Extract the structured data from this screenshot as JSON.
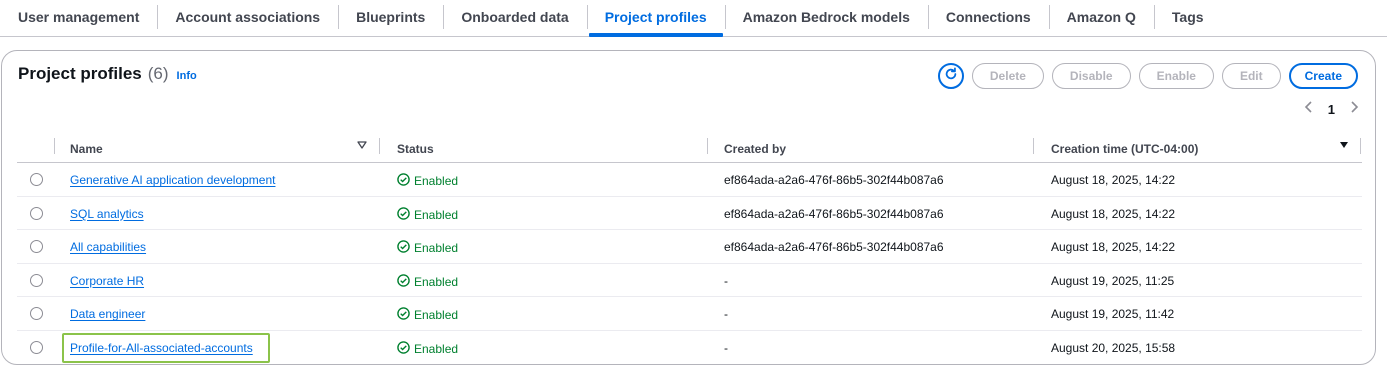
{
  "tabs": [
    {
      "label": "User management",
      "active": false
    },
    {
      "label": "Account associations",
      "active": false
    },
    {
      "label": "Blueprints",
      "active": false
    },
    {
      "label": "Onboarded data",
      "active": false
    },
    {
      "label": "Project profiles",
      "active": true
    },
    {
      "label": "Amazon Bedrock models",
      "active": false
    },
    {
      "label": "Connections",
      "active": false
    },
    {
      "label": "Amazon Q",
      "active": false
    },
    {
      "label": "Tags",
      "active": false
    }
  ],
  "panel": {
    "title": "Project profiles",
    "count": "(6)",
    "info": "Info"
  },
  "actions": {
    "refresh_icon": "refresh-icon",
    "delete": "Delete",
    "disable": "Disable",
    "enable": "Enable",
    "edit": "Edit",
    "create": "Create"
  },
  "pagination": {
    "page": "1"
  },
  "table": {
    "columns": {
      "name": "Name",
      "status": "Status",
      "created_by": "Created by",
      "creation_time": "Creation time (UTC-04:00)"
    },
    "rows": [
      {
        "name": "Generative AI application development",
        "status": "Enabled",
        "created_by": "ef864ada-a2a6-476f-86b5-302f44b087a6",
        "creation_time": "August 18, 2025, 14:22"
      },
      {
        "name": "SQL analytics",
        "status": "Enabled",
        "created_by": "ef864ada-a2a6-476f-86b5-302f44b087a6",
        "creation_time": "August 18, 2025, 14:22"
      },
      {
        "name": "All capabilities",
        "status": "Enabled",
        "created_by": "ef864ada-a2a6-476f-86b5-302f44b087a6",
        "creation_time": "August 18, 2025, 14:22"
      },
      {
        "name": "Corporate HR",
        "status": "Enabled",
        "created_by": "-",
        "creation_time": "August 19, 2025, 11:25"
      },
      {
        "name": "Data engineer",
        "status": "Enabled",
        "created_by": "-",
        "creation_time": "August 19, 2025, 11:42"
      },
      {
        "name": "Profile-for-All-associated-accounts",
        "status": "Enabled",
        "created_by": "-",
        "creation_time": "August 20, 2025, 15:58"
      }
    ]
  },
  "colors": {
    "accent": "#006ce0",
    "status_enabled": "#00802f",
    "highlight": "#8bc34a"
  }
}
